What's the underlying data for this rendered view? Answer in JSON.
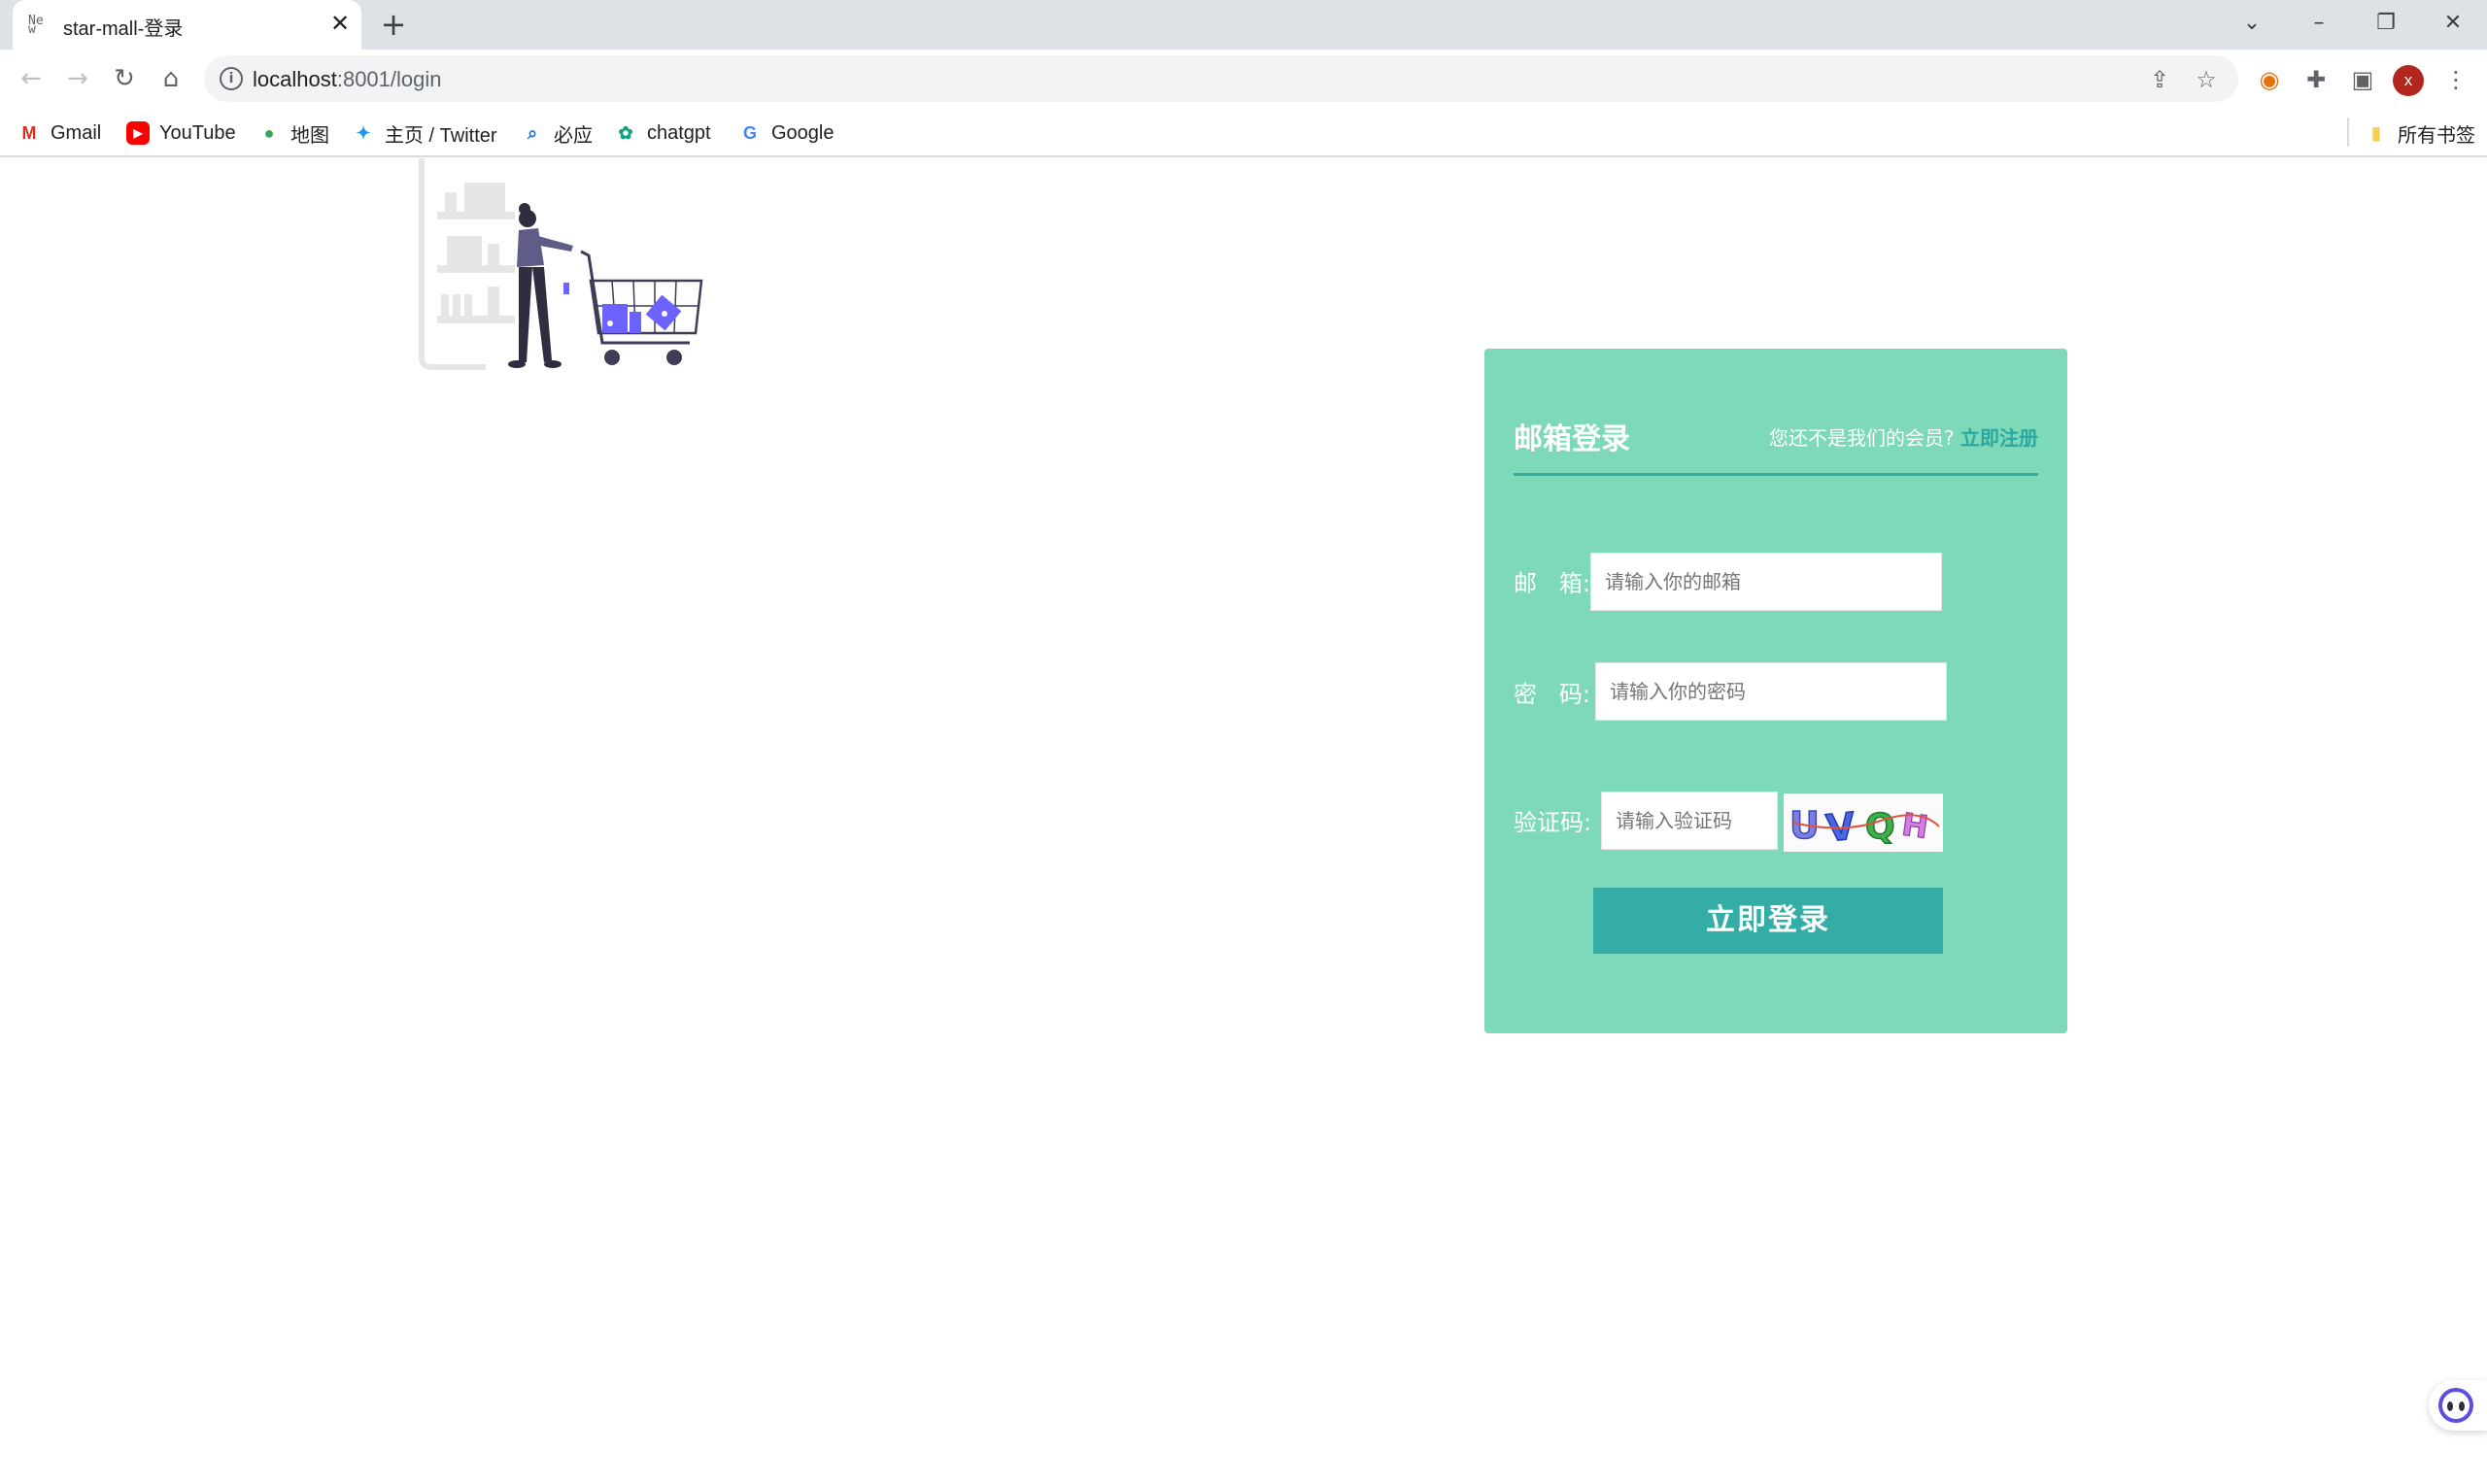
{
  "browser": {
    "tab_title": "star-mall-登录",
    "favicon_text": "Ne\nw",
    "url_host": "localhost",
    "url_rest": ":8001/login",
    "bookmarks": [
      {
        "label": "Gmail",
        "icon": "gmail-icon"
      },
      {
        "label": "YouTube",
        "icon": "youtube-icon"
      },
      {
        "label": "地图",
        "icon": "maps-icon"
      },
      {
        "label": "主页 / Twitter",
        "icon": "twitter-icon"
      },
      {
        "label": "必应",
        "icon": "bing-icon"
      },
      {
        "label": "chatgpt",
        "icon": "chatgpt-icon"
      },
      {
        "label": "Google",
        "icon": "google-icon"
      }
    ],
    "all_bookmarks": "所有书签",
    "avatar_letter": "x"
  },
  "login": {
    "title": "邮箱登录",
    "prompt": "您还不是我们的会员?",
    "register_link": "立即注册",
    "email_label": "邮   箱:",
    "email_placeholder": "请输入你的邮箱",
    "password_label": "密   码:",
    "password_placeholder": "请输入你的密码",
    "captcha_label": "验证码:",
    "captcha_placeholder": "请输入验证码",
    "captcha_text": "UVQH",
    "submit": "立即登录"
  },
  "colors": {
    "card_bg": "#7dd9b8",
    "accent": "#34ada7",
    "link": "#2ba7a0"
  }
}
